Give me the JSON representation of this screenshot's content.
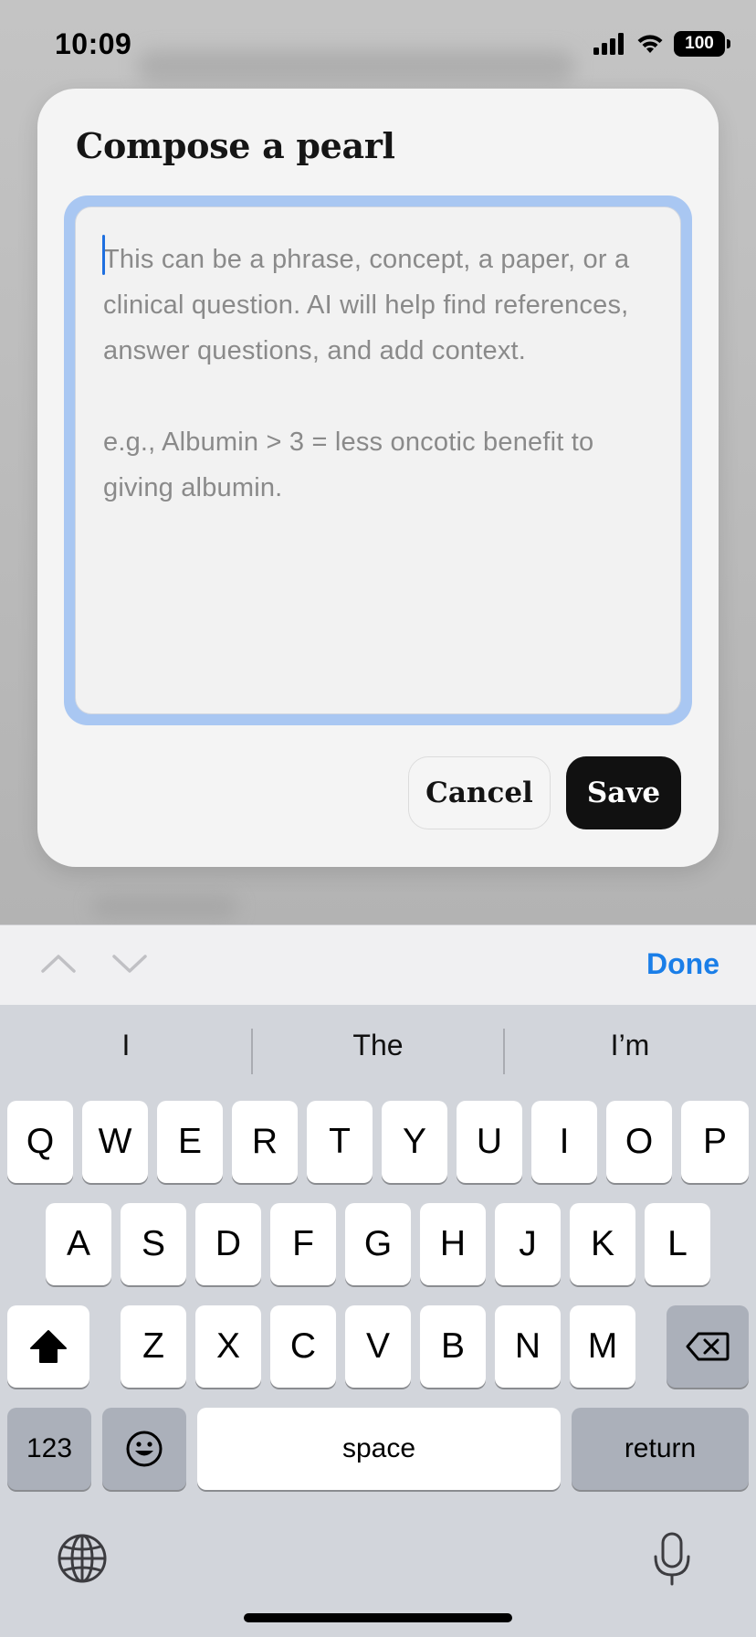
{
  "status_bar": {
    "time": "10:09",
    "battery": "100"
  },
  "dialog": {
    "title": "Compose a pearl",
    "placeholder": "This can be a phrase, concept, a paper, or a clinical question. AI will help find references, answer questions, and add context.\n\ne.g., Albumin > 3 = less oncotic benefit to giving albumin.",
    "cancel_label": "Cancel",
    "save_label": "Save"
  },
  "accessory": {
    "done_label": "Done"
  },
  "keyboard": {
    "suggestions": [
      "I",
      "The",
      "I’m"
    ],
    "row1": [
      "Q",
      "W",
      "E",
      "R",
      "T",
      "Y",
      "U",
      "I",
      "O",
      "P"
    ],
    "row2": [
      "A",
      "S",
      "D",
      "F",
      "G",
      "H",
      "J",
      "K",
      "L"
    ],
    "row3": [
      "Z",
      "X",
      "C",
      "V",
      "B",
      "N",
      "M"
    ],
    "numbers_label": "123",
    "space_label": "space",
    "return_label": "return"
  },
  "colors": {
    "accent": "#1a7ee8",
    "focus_ring": "#a9c7f2",
    "save_button": "#111111"
  }
}
